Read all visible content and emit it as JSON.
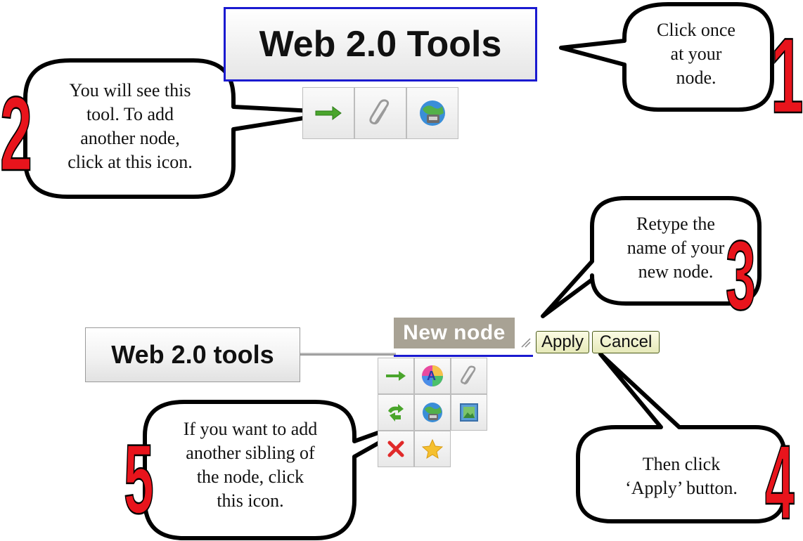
{
  "top_node": {
    "label": "Web 2.0 Tools"
  },
  "top_toolbar": {
    "icons": [
      "add-child-arrow-icon",
      "attachment-clip-icon",
      "add-sibling-globe-icon"
    ]
  },
  "bottom_node": {
    "label": "Web 2.0 tools"
  },
  "edit": {
    "value": "New node",
    "apply_label": "Apply",
    "cancel_label": "Cancel"
  },
  "bottom_toolbar": {
    "icons": [
      "add-child-arrow-icon",
      "color-palette-icon",
      "attachment-clip-icon",
      "swap-arrows-icon",
      "add-sibling-globe-icon",
      "image-icon",
      "delete-x-icon",
      "star-icon"
    ]
  },
  "steps": [
    {
      "number": "1",
      "text": [
        "Click once",
        "at your",
        "node."
      ]
    },
    {
      "number": "2",
      "text": [
        "You will see this",
        "tool. To add",
        "another node,",
        "click at this icon."
      ]
    },
    {
      "number": "3",
      "text": [
        "Retype the",
        "name of your",
        "new node."
      ]
    },
    {
      "number": "4",
      "text": [
        "Then click",
        "‘Apply’ button."
      ]
    },
    {
      "number": "5",
      "text": [
        "If you want to add",
        "another sibling of",
        "the node, click",
        "this icon."
      ]
    }
  ],
  "colors": {
    "step_number_red": "#e8141c",
    "node_border_blue": "#1a1ad0",
    "edit_field_bg": "#a8a294"
  }
}
